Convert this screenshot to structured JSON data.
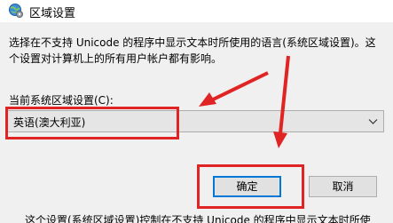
{
  "window": {
    "title": "区域设置",
    "icon": "globe-settings-icon"
  },
  "description": "选择在不支持 Unicode 的程序中显示文本时所使用的语言(系统区域设置)。这个设置对计算机上的所有用户帐户都有影响。",
  "locale": {
    "label": "当前系统区域设置(C):",
    "selected": "英语(澳大利亚)"
  },
  "buttons": {
    "ok": "确定",
    "cancel": "取消"
  },
  "clipped_text": "这个设置(系统区域设置)控制在不支持 Unicode 的程序中显示文本时所使",
  "colors": {
    "annotation": "#e02424",
    "focus_border": "#0078d7"
  }
}
